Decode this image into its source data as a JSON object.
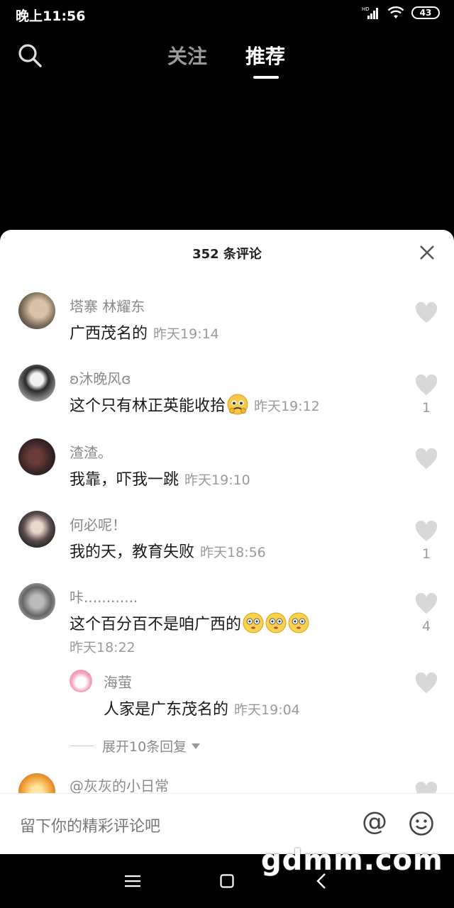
{
  "status": {
    "time": "晚上11:56",
    "battery": "43",
    "network": "HD"
  },
  "nav": {
    "tab_follow": "关注",
    "tab_recommend": "推荐"
  },
  "sheet": {
    "title": "352 条评论"
  },
  "comments": [
    {
      "author": "塔寨  林耀东",
      "text": "广西茂名的",
      "time": "昨天19:14",
      "likes": ""
    },
    {
      "author": "ʚ沐晚风ɞ",
      "text": "这个只有林正英能收拾",
      "time": "昨天19:12",
      "likes": "1"
    },
    {
      "author": "渣渣。",
      "text": "我靠，吓我一跳",
      "time": "昨天19:10",
      "likes": ""
    },
    {
      "author": "何必呢！",
      "text": "我的天，教育失败",
      "time": "昨天18:56",
      "likes": "1"
    },
    {
      "author": "咔............",
      "text": "这个百分百不是咱广西的",
      "time": "昨天18:22",
      "likes": "4"
    },
    {
      "author": "@灰灰的小日常",
      "text": "",
      "time": "",
      "likes": ""
    }
  ],
  "reply": {
    "author": "海萤",
    "text": "人家是广东茂名的",
    "time": "昨天19:04"
  },
  "expand": {
    "label": "展开10条回复"
  },
  "input": {
    "placeholder": "留下你的精彩评论吧"
  },
  "watermark": "gdmm.com",
  "colors": {
    "sheet_bg": "#ffffff",
    "page_bg": "#000000",
    "muted": "#9a9a9a"
  }
}
